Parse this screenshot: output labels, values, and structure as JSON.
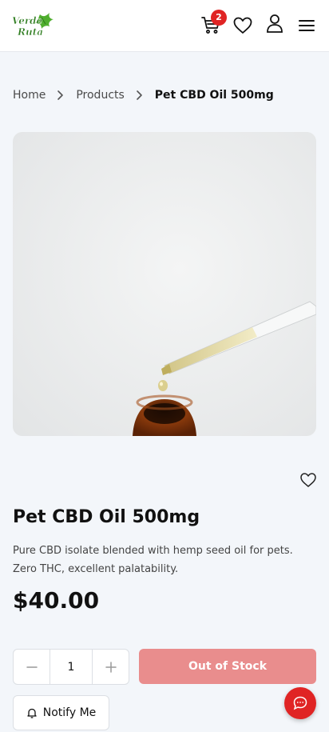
{
  "header": {
    "logo_text": "Verde Ruta",
    "cart_count": "2"
  },
  "breadcrumb": {
    "home": "Home",
    "products": "Products",
    "current": "Pet CBD Oil 500mg"
  },
  "product": {
    "title": "Pet CBD Oil 500mg",
    "description": "Pure CBD isolate blended with hemp seed oil for pets. Zero THC, excellent palatability.",
    "price": "$40.00",
    "quantity": "1",
    "stock_label": "Out of Stock",
    "notify_label": "Notify Me"
  },
  "colors": {
    "accent_red": "#e02424",
    "out_of_stock_bg": "#e98d8d",
    "logo_green": "#3a9a2a",
    "page_bg": "#f3f6fa"
  },
  "icons": [
    "cart-icon",
    "heart-icon",
    "user-icon",
    "menu-icon",
    "chevron-right-icon",
    "minus-icon",
    "plus-icon",
    "bell-icon",
    "chat-icon"
  ]
}
